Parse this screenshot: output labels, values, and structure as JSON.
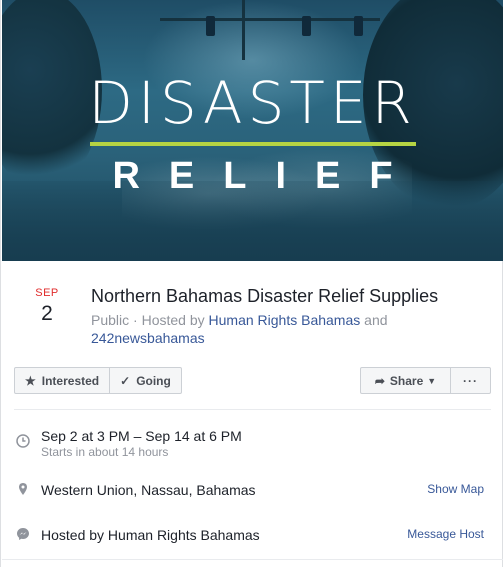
{
  "cover": {
    "line1": "DISASTER",
    "line2": "RELIEF",
    "accent_color": "#b6d443"
  },
  "event": {
    "month": "SEP",
    "day": "2",
    "title": "Northern Bahamas Disaster Relief Supplies",
    "privacy": "Public",
    "hosted_by_prefix": " · Hosted by ",
    "host1": "Human Rights Bahamas",
    "and": " and",
    "host2": "242newsbahamas"
  },
  "actions": {
    "interested_label": "Interested",
    "going_label": "Going",
    "share_label": "Share",
    "more_label": "···"
  },
  "details": {
    "time_main": "Sep 2 at 3 PM – Sep 14 at 6 PM",
    "time_sub": "Starts in about 14 hours",
    "location": "Western Union, Nassau, Bahamas",
    "show_map": "Show Map",
    "hosted_by": "Hosted by Human Rights Bahamas",
    "message_host": "Message Host"
  },
  "colors": {
    "link": "#385898",
    "date_month": "#e02b2b",
    "meta": "#90949c"
  }
}
